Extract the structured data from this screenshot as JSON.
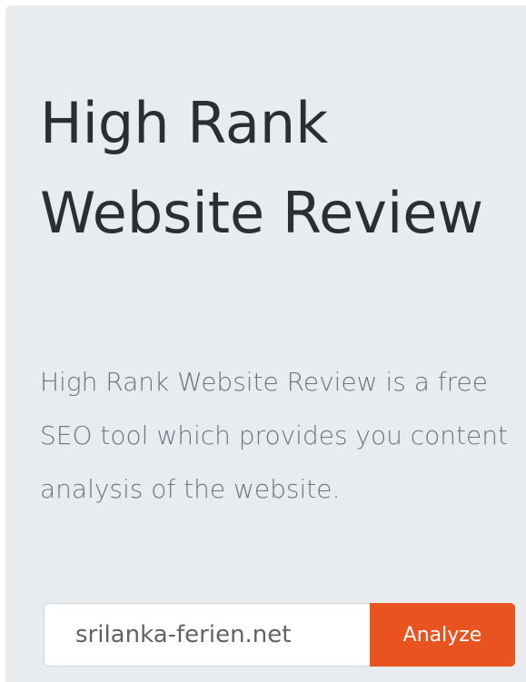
{
  "hero": {
    "title": "High Rank Website Review",
    "description": "High Rank Website Review is a free SEO tool which provides you content analysis of the website."
  },
  "search_form": {
    "url_value": "srilanka-ferien.net",
    "analyze_label": "Analyze",
    "button_color": "#e8531f"
  },
  "colors": {
    "panel_background": "#e9ecef",
    "title_text": "#2b2f33",
    "lead_text": "#6c757d"
  }
}
